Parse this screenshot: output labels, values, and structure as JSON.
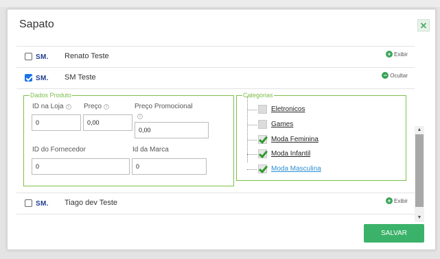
{
  "modal": {
    "title": "Sapato",
    "close_icon": "close-x-icon",
    "save_label": "SALVAR"
  },
  "rows": [
    {
      "logo": "SM.",
      "name": "Renato Teste",
      "checked": false,
      "toggle_label": "Exibir",
      "toggle_icon": "plus-circle-icon"
    },
    {
      "logo": "SM.",
      "name": "SM Teste",
      "checked": true,
      "toggle_label": "Ocultar",
      "toggle_icon": "minus-circle-icon"
    },
    {
      "logo": "SM.",
      "name": "Tiago dev Teste",
      "checked": false,
      "toggle_label": "Exibir",
      "toggle_icon": "plus-circle-icon"
    }
  ],
  "details": {
    "dados_legend": "Dados Produto",
    "fields": {
      "id_loja": {
        "label": "ID na Loja",
        "value": "0"
      },
      "preco": {
        "label": "Preço",
        "value": "0,00"
      },
      "preco_promocional": {
        "label": "Preço Promocional",
        "value": "0,00"
      },
      "id_fornecedor": {
        "label": "ID do Fornecedor",
        "value": "0"
      },
      "id_marca": {
        "label": "Id da Marca",
        "value": "0"
      }
    },
    "categorias_legend": "Categorias",
    "categorias": [
      {
        "label": "Eletronicos",
        "checked": false
      },
      {
        "label": "Games",
        "checked": false
      },
      {
        "label": "Moda Feminina",
        "checked": true
      },
      {
        "label": "Moda Infantil",
        "checked": true
      },
      {
        "label": "Moda Masculina",
        "checked": true,
        "link": true
      }
    ]
  },
  "colors": {
    "accent_green": "#3bb26a",
    "fieldset_border": "#7cbf48",
    "checkbox_blue": "#1a73e8",
    "link_blue": "#2b8fd1",
    "logo_navy": "#1e3c8c"
  }
}
